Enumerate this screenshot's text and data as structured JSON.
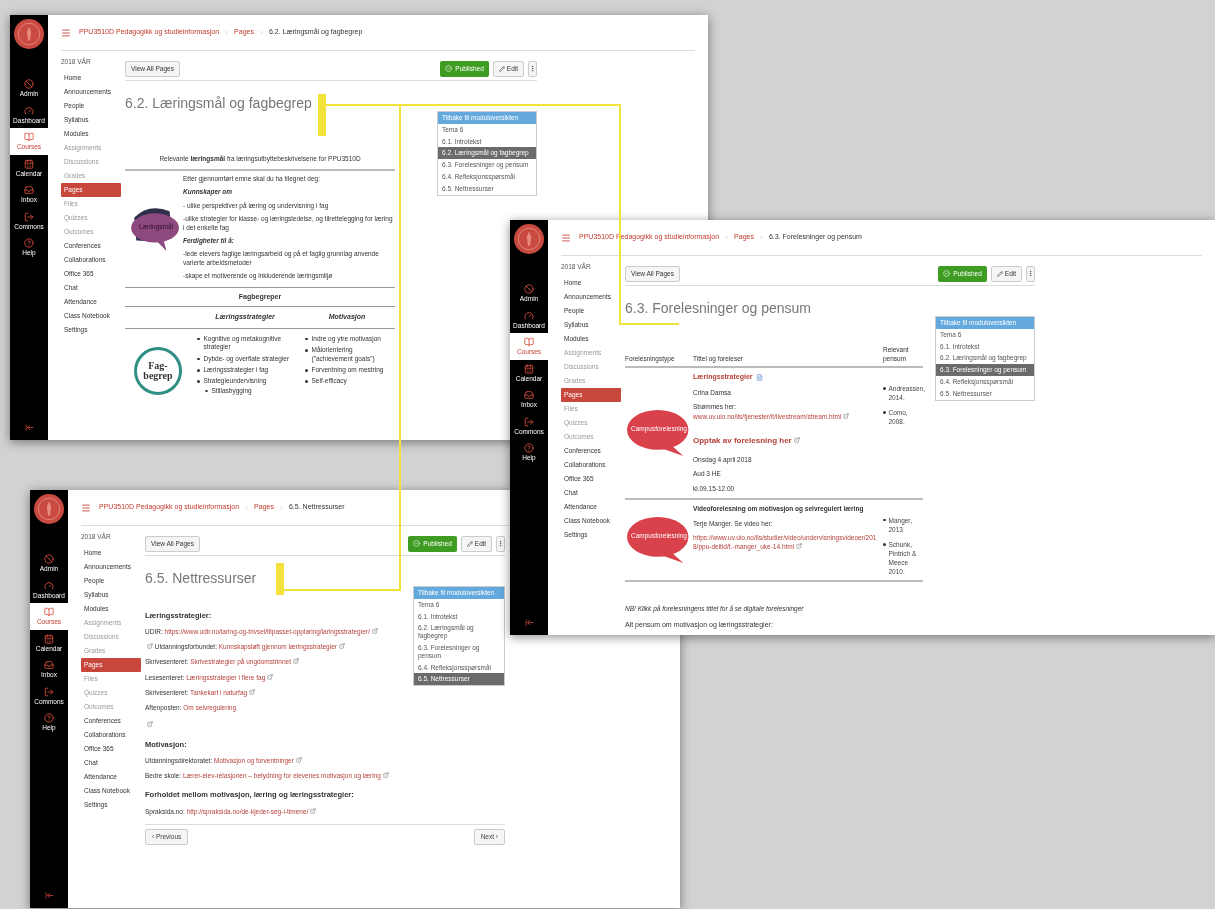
{
  "windows": [
    {
      "rail": {
        "items": [
          {
            "label": "Admin",
            "selected": false
          },
          {
            "label": "Dashboard",
            "selected": false
          },
          {
            "label": "Courses",
            "selected": true
          },
          {
            "label": "Calendar",
            "selected": false
          },
          {
            "label": "Inbox",
            "selected": false
          },
          {
            "label": "Commons",
            "selected": false
          },
          {
            "label": "Help",
            "selected": false
          }
        ]
      },
      "breadcrumb": [
        "PPU3510D Pedagogikk og studieinformasjon",
        "Pages",
        "6.2. Læringsmål og fagbegrep"
      ],
      "course_nav": {
        "term": "2018 VÅR",
        "items": [
          {
            "label": "Home",
            "selected": false,
            "disabled": false
          },
          {
            "label": "Announcements",
            "selected": false,
            "disabled": false
          },
          {
            "label": "People",
            "selected": false,
            "disabled": false
          },
          {
            "label": "Syllabus",
            "selected": false,
            "disabled": false
          },
          {
            "label": "Modules",
            "selected": false,
            "disabled": false
          },
          {
            "label": "Assignments",
            "selected": false,
            "disabled": true
          },
          {
            "label": "Discussions",
            "selected": false,
            "disabled": true
          },
          {
            "label": "Grades",
            "selected": false,
            "disabled": true
          },
          {
            "label": "Pages",
            "selected": true,
            "disabled": false
          },
          {
            "label": "Files",
            "selected": false,
            "disabled": true
          },
          {
            "label": "Quizzes",
            "selected": false,
            "disabled": true
          },
          {
            "label": "Outcomes",
            "selected": false,
            "disabled": true
          },
          {
            "label": "Conferences",
            "selected": false,
            "disabled": false
          },
          {
            "label": "Collaborations",
            "selected": false,
            "disabled": false
          },
          {
            "label": "Office 365",
            "selected": false,
            "disabled": false
          },
          {
            "label": "Chat",
            "selected": false,
            "disabled": false
          },
          {
            "label": "Attendance",
            "selected": false,
            "disabled": false
          },
          {
            "label": "Class Notebook",
            "selected": false,
            "disabled": false
          },
          {
            "label": "Settings",
            "selected": false,
            "disabled": false
          }
        ]
      },
      "toolbar": {
        "view_all": "View All Pages",
        "published": "Published",
        "edit": "Edit"
      },
      "title": "6.2. Læringsmål og fagbegrep",
      "module_nav": {
        "header": "Tilbake til moduloversikten",
        "items": [
          {
            "label": "Tema 6",
            "selected": false
          },
          {
            "label": "6.1. Introtekst",
            "selected": false
          },
          {
            "label": "6.2. Læringsmål og fagbegrep",
            "selected": true
          },
          {
            "label": "6.3. Forelesninger og pensum",
            "selected": false
          },
          {
            "label": "6.4. Refleksjonsspørsmål",
            "selected": false
          },
          {
            "label": "6.5. Nettressurser",
            "selected": false
          }
        ]
      },
      "content": {
        "kind": "objectives",
        "intro": "Relevante **læringsmål** fra læringsutbyttebeskrivelsene for PPU3510D",
        "bubble": "Læringsmål",
        "paragraphs": [
          {
            "kind": "text",
            "text": "Etter gjennomført emne skal du ha tilegnet deg:"
          },
          {
            "kind": "heading",
            "text": "Kunnskaper om"
          },
          {
            "kind": "text",
            "text": "- ulike perspektiver på læring og undervisning i fag"
          },
          {
            "kind": "text",
            "text": "-ulike strategier for klasse- og læringsledelse, og tilrettelegging for læring i det enkelte fag"
          },
          {
            "kind": "heading",
            "text": "Ferdigheter til å:"
          },
          {
            "kind": "text",
            "text": "-lede elevers faglige læringsarbeid og på et faglig grunnlag anvende varierte arbeidsmetoder"
          },
          {
            "kind": "text",
            "text": "-skape et motiverende og inkluderende læringsmiljø"
          }
        ],
        "section_title": "Fagbegreper",
        "circle": "Fag-begrep",
        "columns": [
          {
            "title": "Læringsstrategier",
            "items": [
              {
                "text": "Kognitive og metakognitive strategier"
              },
              {
                "text": "Dybde- og overflate strategier"
              },
              {
                "text": "Læringsstrategier i fag"
              },
              {
                "text": "Strategieundervisning",
                "children": [
                  {
                    "text": "Stillasbygging"
                  }
                ]
              }
            ]
          },
          {
            "title": "Motivasjon",
            "items": [
              {
                "text": "Indre og ytre motivasjon"
              },
              {
                "text": "Målorientering (\"achievement goals\")"
              },
              {
                "text": "Forventning om mestring"
              },
              {
                "text": "Self-efficacy"
              }
            ]
          }
        ]
      }
    },
    {
      "rail": {
        "items": [
          {
            "label": "Admin",
            "selected": false
          },
          {
            "label": "Dashboard",
            "selected": false
          },
          {
            "label": "Courses",
            "selected": true
          },
          {
            "label": "Calendar",
            "selected": false
          },
          {
            "label": "Inbox",
            "selected": false
          },
          {
            "label": "Commons",
            "selected": false
          },
          {
            "label": "Help",
            "selected": false
          }
        ]
      },
      "breadcrumb": [
        "PPU3510D Pedagogikk og studieinformasjon",
        "Pages",
        "6.3. Forelesninger og pensum"
      ],
      "course_nav": {
        "term": "2018 VÅR",
        "items": [
          {
            "label": "Home",
            "selected": false,
            "disabled": false
          },
          {
            "label": "Announcements",
            "selected": false,
            "disabled": false
          },
          {
            "label": "People",
            "selected": false,
            "disabled": false
          },
          {
            "label": "Syllabus",
            "selected": false,
            "disabled": false
          },
          {
            "label": "Modules",
            "selected": false,
            "disabled": false
          },
          {
            "label": "Assignments",
            "selected": false,
            "disabled": true
          },
          {
            "label": "Discussions",
            "selected": false,
            "disabled": true
          },
          {
            "label": "Grades",
            "selected": false,
            "disabled": true
          },
          {
            "label": "Pages",
            "selected": true,
            "disabled": false
          },
          {
            "label": "Files",
            "selected": false,
            "disabled": true
          },
          {
            "label": "Quizzes",
            "selected": false,
            "disabled": true
          },
          {
            "label": "Outcomes",
            "selected": false,
            "disabled": true
          },
          {
            "label": "Conferences",
            "selected": false,
            "disabled": false
          },
          {
            "label": "Collaborations",
            "selected": false,
            "disabled": false
          },
          {
            "label": "Office 365",
            "selected": false,
            "disabled": false
          },
          {
            "label": "Chat",
            "selected": false,
            "disabled": false
          },
          {
            "label": "Attendance",
            "selected": false,
            "disabled": false
          },
          {
            "label": "Class Notebook",
            "selected": false,
            "disabled": false
          },
          {
            "label": "Settings",
            "selected": false,
            "disabled": false
          }
        ]
      },
      "toolbar": {
        "view_all": "View All Pages",
        "published": "Published",
        "edit": "Edit"
      },
      "title": "6.3. Forelesninger og pensum",
      "module_nav": {
        "header": "Tilbake til moduloversikten",
        "items": [
          {
            "label": "Tema 6",
            "selected": false
          },
          {
            "label": "6.1. Introtekst",
            "selected": false
          },
          {
            "label": "6.2. Læringsmål og fagbegrep",
            "selected": false
          },
          {
            "label": "6.3. Forelesninger og pensum",
            "selected": true
          },
          {
            "label": "6.4. Refleksjonsspørsmål",
            "selected": false
          },
          {
            "label": "6.5. Nettressurser",
            "selected": false
          }
        ]
      },
      "content": {
        "kind": "lectures",
        "columns": [
          "Forelesningstype",
          "Tittel og foreleser",
          "Relevant pensum"
        ],
        "rows": [
          {
            "bubble": "Campusforelesning",
            "lines": [
              {
                "kind": "title_link",
                "text": "Læringsstrategier"
              },
              {
                "kind": "text",
                "text": "Crina Damsa"
              },
              {
                "kind": "labeled_link",
                "label": "Strømmes her:",
                "link": "www.uv.uio.no/ils/tjenester/it/livestream/stream.html"
              },
              {
                "kind": "big_link",
                "text": "Opptak av forelesning her"
              },
              {
                "kind": "text",
                "text": "Onsdag 4 april 2018"
              },
              {
                "kind": "text",
                "text": "Aud 3 HE"
              },
              {
                "kind": "text",
                "text": "kl.09.15-12.00"
              }
            ],
            "pensum": [
              "Andreassen, 2014.",
              "Como, 2008."
            ]
          },
          {
            "bubble": "Campusforelesning",
            "lines": [
              {
                "kind": "bold",
                "text": "Videoforelesning om motivasjon og selvregulert læring"
              },
              {
                "kind": "text",
                "text": "Terje Manger. Se video her:"
              },
              {
                "kind": "link",
                "text": "https://www.uv.uio.no/ils/studier/video/undervisningsvideoer/2018/ppu-deltid/t.-manger_uke-14.html"
              }
            ],
            "pensum": [
              "Manger, 2013",
              "Schunk, Pintrich & Meece 2010."
            ]
          }
        ],
        "note": "NB! Klikk på forelesningens tittel for å se digitale forelesninger",
        "footer": "Alt pensum om motivasjon og læringsstrategier:"
      }
    },
    {
      "rail": {
        "items": [
          {
            "label": "Admin",
            "selected": false
          },
          {
            "label": "Dashboard",
            "selected": false
          },
          {
            "label": "Courses",
            "selected": true
          },
          {
            "label": "Calendar",
            "selected": false
          },
          {
            "label": "Inbox",
            "selected": false
          },
          {
            "label": "Commons",
            "selected": false
          },
          {
            "label": "Help",
            "selected": false
          }
        ]
      },
      "breadcrumb": [
        "PPU3510D Pedagogikk og studieinformasjon",
        "Pages",
        "6.5. Nettressurser"
      ],
      "course_nav": {
        "term": "2018 VÅR",
        "items": [
          {
            "label": "Home",
            "selected": false,
            "disabled": false
          },
          {
            "label": "Announcements",
            "selected": false,
            "disabled": false
          },
          {
            "label": "People",
            "selected": false,
            "disabled": false
          },
          {
            "label": "Syllabus",
            "selected": false,
            "disabled": false
          },
          {
            "label": "Modules",
            "selected": false,
            "disabled": false
          },
          {
            "label": "Assignments",
            "selected": false,
            "disabled": true
          },
          {
            "label": "Discussions",
            "selected": false,
            "disabled": true
          },
          {
            "label": "Grades",
            "selected": false,
            "disabled": true
          },
          {
            "label": "Pages",
            "selected": true,
            "disabled": false
          },
          {
            "label": "Files",
            "selected": false,
            "disabled": true
          },
          {
            "label": "Quizzes",
            "selected": false,
            "disabled": true
          },
          {
            "label": "Outcomes",
            "selected": false,
            "disabled": true
          },
          {
            "label": "Conferences",
            "selected": false,
            "disabled": false
          },
          {
            "label": "Collaborations",
            "selected": false,
            "disabled": false
          },
          {
            "label": "Office 365",
            "selected": false,
            "disabled": false
          },
          {
            "label": "Chat",
            "selected": false,
            "disabled": false
          },
          {
            "label": "Attendance",
            "selected": false,
            "disabled": false
          },
          {
            "label": "Class Notebook",
            "selected": false,
            "disabled": false
          },
          {
            "label": "Settings",
            "selected": false,
            "disabled": false
          }
        ]
      },
      "toolbar": {
        "view_all": "View All Pages",
        "published": "Published",
        "edit": "Edit"
      },
      "title": "6.5. Nettressurser",
      "module_nav": {
        "header": "Tilbake til moduloversikten",
        "items": [
          {
            "label": "Tema 6",
            "selected": false
          },
          {
            "label": "6.1. Introtekst",
            "selected": false
          },
          {
            "label": "6.2. Læringsmål og fagbegrep",
            "selected": false
          },
          {
            "label": "6.3. Forelesninger og pensum",
            "selected": false
          },
          {
            "label": "6.4. Refleksjonsspørsmål",
            "selected": false
          },
          {
            "label": "6.5. Nettressurser",
            "selected": true
          }
        ]
      },
      "content": {
        "kind": "resources",
        "lines": [
          {
            "kind": "heading",
            "text": "Læringsstrategier:"
          },
          {
            "kind": "labeled_link",
            "label": "UDIR:",
            "link": "https://www.udir.no/laring-og-trivsel/tilpasset-opplaring/laringsstrategier/",
            "lead_icon": false,
            "external": true
          },
          {
            "kind": "labeled_link",
            "label": "Utdanningsforbundet:",
            "link": "Kunnskapsløft gjennom læringsstrategier",
            "lead_icon": true,
            "external": true
          },
          {
            "kind": "labeled_link",
            "label": "Skrivesenteret:",
            "link": "Skrivestrategier på ungdomstrinnet",
            "lead_icon": false,
            "external": true
          },
          {
            "kind": "labeled_link",
            "label": "Lesesenteret:",
            "link": "Læringsstrategier i flere fag",
            "lead_icon": false,
            "external": true
          },
          {
            "kind": "labeled_link",
            "label": "Skrivesenteret:",
            "link": "Tankekart i naturfag",
            "lead_icon": false,
            "external": true
          },
          {
            "kind": "labeled_link",
            "label": "Aftenposten:",
            "link": "Om selvregulering",
            "lead_icon": false,
            "external": false
          },
          {
            "kind": "icon"
          },
          {
            "kind": "heading",
            "text": "Motivasjon:"
          },
          {
            "kind": "labeled_link",
            "label": "Utdanningsdirektoratet:",
            "link": "Motivasjon og forventninger",
            "lead_icon": false,
            "external": true
          },
          {
            "kind": "labeled_link",
            "label": "Bedre skole:",
            "link": "Lærer-elev-relasjonen – betydning for elevenes motivasjon og læring",
            "lead_icon": false,
            "external": true
          },
          {
            "kind": "heading",
            "text": "Forholdet mellom motivasjon, læring og læringsstrategier:"
          },
          {
            "kind": "labeled_link",
            "label": "Spraksida.no:",
            "link": "http://spraksida.no/de-kjeder-seg-i-timene/",
            "lead_icon": false,
            "external": true
          }
        ]
      },
      "pager": {
        "previous": "‹ Previous",
        "next": "Next ›"
      }
    }
  ]
}
